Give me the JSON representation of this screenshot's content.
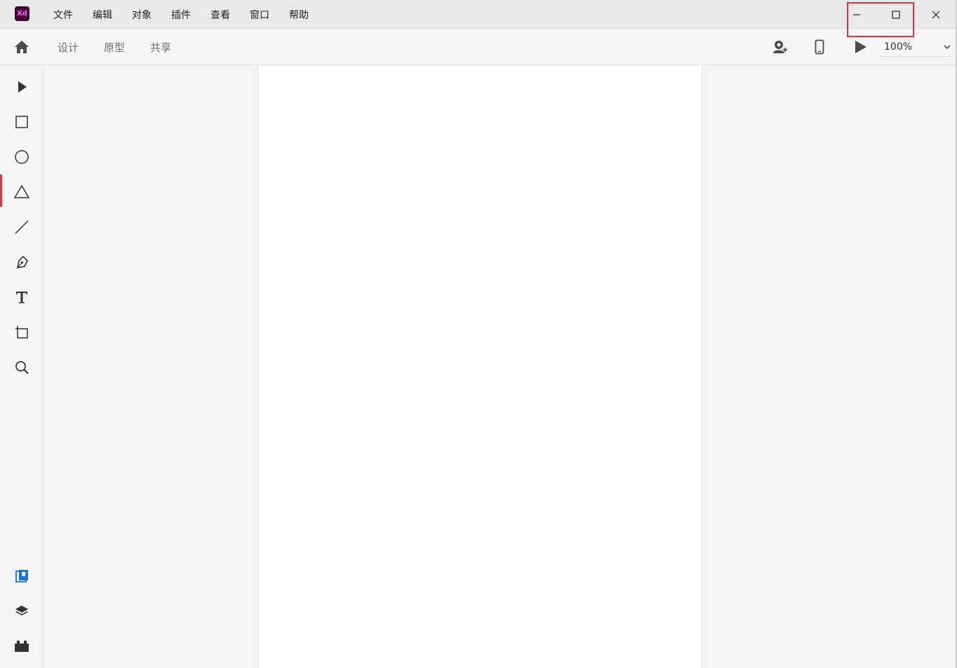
{
  "app": {
    "logo_text": "Xd"
  },
  "menu": {
    "items": [
      {
        "label": "文件"
      },
      {
        "label": "编辑"
      },
      {
        "label": "对象"
      },
      {
        "label": "插件"
      },
      {
        "label": "查看"
      },
      {
        "label": "窗口"
      },
      {
        "label": "帮助"
      }
    ]
  },
  "window_controls": {
    "minimize_icon": "minimize-icon",
    "maximize_icon": "maximize-icon",
    "close_icon": "close-icon"
  },
  "toolbar": {
    "home_icon": "home-icon",
    "tabs": [
      {
        "label": "设计"
      },
      {
        "label": "原型"
      },
      {
        "label": "共享"
      }
    ],
    "invite_icon": "add-user-icon",
    "device_icon": "mobile-device-icon",
    "play_icon": "play-icon",
    "zoom": {
      "value": "100%"
    }
  },
  "tools": [
    {
      "name": "select-tool",
      "icon": "arrow-pointer-icon"
    },
    {
      "name": "rectangle-tool",
      "icon": "rectangle-icon"
    },
    {
      "name": "ellipse-tool",
      "icon": "ellipse-icon"
    },
    {
      "name": "polygon-tool",
      "icon": "triangle-icon"
    },
    {
      "name": "line-tool",
      "icon": "line-icon"
    },
    {
      "name": "pen-tool",
      "icon": "pen-icon"
    },
    {
      "name": "text-tool",
      "icon": "text-icon"
    },
    {
      "name": "artboard-tool",
      "icon": "artboard-icon"
    },
    {
      "name": "zoom-tool",
      "icon": "magnifier-icon"
    }
  ],
  "bottom_tools": [
    {
      "name": "document-assets",
      "icon": "assets-icon"
    },
    {
      "name": "layers",
      "icon": "layers-icon"
    },
    {
      "name": "plugins",
      "icon": "plugins-icon"
    }
  ],
  "colors": {
    "logo_bg": "#470137",
    "logo_text": "#ff61f6",
    "highlight": "#e0343c",
    "accent_blue": "#1473e6"
  }
}
